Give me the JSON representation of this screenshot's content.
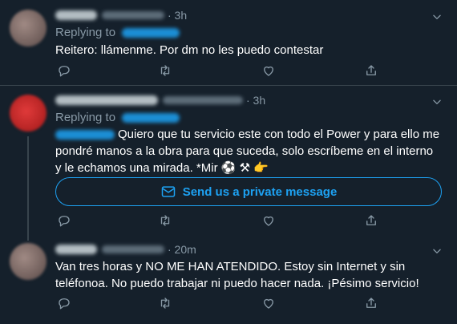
{
  "tweets": [
    {
      "time": "· 3h",
      "replying_label": "Replying to",
      "text": "Reitero: llámenme. Por dm no les puedo contestar"
    },
    {
      "time": "· 3h",
      "replying_label": "Replying to",
      "text": "Quiero que tu servicio este con todo el Power y para ello me pondré manos a la obra para que suceda, solo escríbeme en el interno y le echamos una mirada. *Mir ⚽ ⚒ 👉",
      "dm_button_label": "Send us a private message"
    },
    {
      "time": "· 20m",
      "text": "Van tres horas y NO ME HAN ATENDIDO. Estoy sin Internet y sin teléfonoa. No puedo trabajar ni puedo hacer nada. ¡Pésimo servicio!"
    }
  ],
  "icons": [
    "reply-icon",
    "retweet-icon",
    "like-icon",
    "share-icon",
    "chevron-down-icon",
    "mail-icon"
  ],
  "colors": {
    "background": "#15202b",
    "accent": "#1da1f2",
    "muted": "#8899a6",
    "divider": "#38444d"
  }
}
